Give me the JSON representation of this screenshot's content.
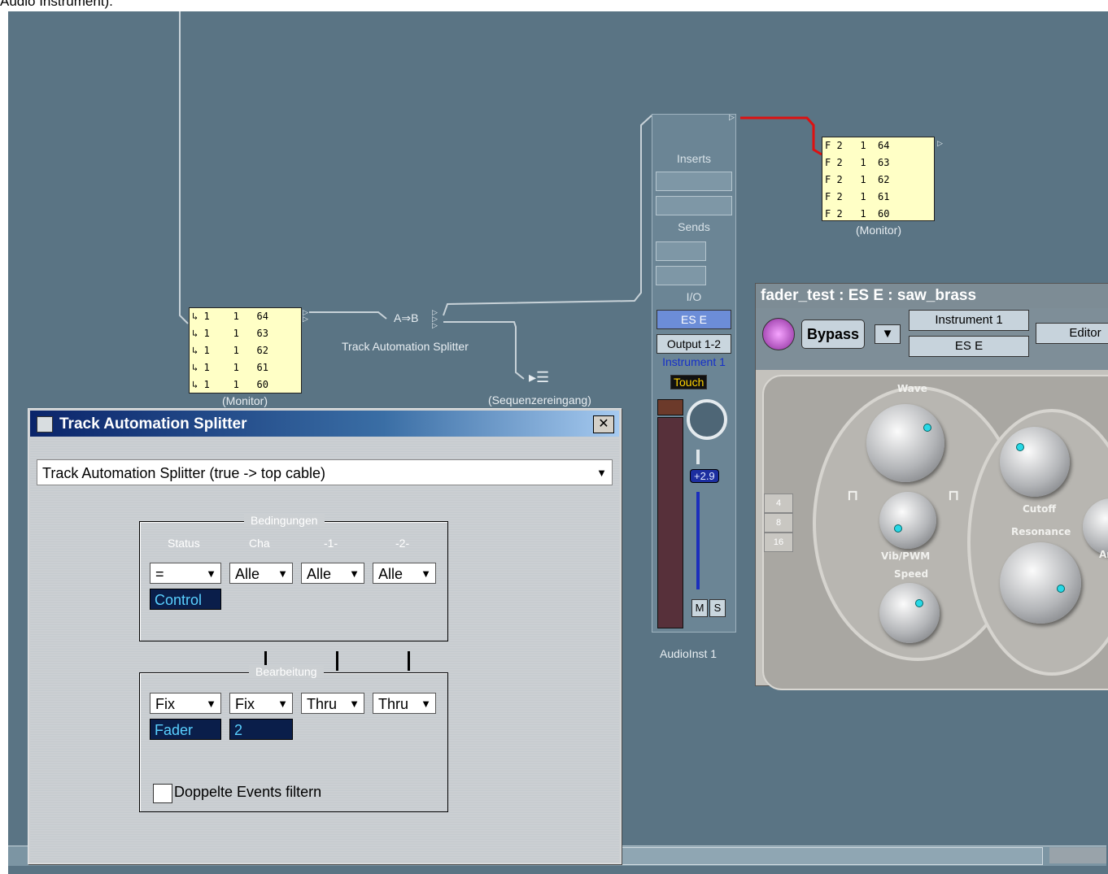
{
  "caption": "Audio Instrument).",
  "monitor_left": {
    "rows": [
      "↳ 1    1   64",
      "↳ 1    1   63",
      "↳ 1    1   62",
      "↳ 1    1   61",
      "↳ 1    1   60"
    ],
    "label": "(Monitor)"
  },
  "monitor_right": {
    "rows": [
      "F 2   1  64",
      "F 2   1  63",
      "F 2   1  62",
      "F 2   1  61",
      "F 2   1  60"
    ],
    "label": "(Monitor)"
  },
  "splitter_object": {
    "glyph": "A⇒B",
    "label": "Track Automation Splitter"
  },
  "sequencer_input": {
    "label": "(Sequenzereingang)"
  },
  "channel_strip": {
    "inserts_label": "Inserts",
    "sends_label": "Sends",
    "io_label": "I/O",
    "input": "ES E",
    "output": "Output 1-2",
    "instrument": "Instrument 1",
    "automation": "Touch",
    "volume": "+2.9",
    "mute": "M",
    "solo": "S",
    "name": "AudioInst 1",
    "cable_color": "#dd1111"
  },
  "dialog": {
    "title": "Track Automation Splitter",
    "close": "✕",
    "preset": "Track Automation Splitter (true -> top cable)",
    "conditions": {
      "legend": "Bedingungen",
      "headers": [
        "Status",
        "Cha",
        "-1-",
        "-2-"
      ],
      "selects": [
        "=",
        "Alle",
        "Alle",
        "Alle"
      ],
      "value": "Control"
    },
    "processing": {
      "legend": "Bearbeitung",
      "selects": [
        "Fix",
        "Fix",
        "Thru",
        "Thru"
      ],
      "values": [
        "Fader",
        "2"
      ]
    },
    "checkbox_label": "Doppelte Events filtern",
    "checkbox_checked": false
  },
  "plugin": {
    "title": "fader_test : ES E : saw_brass",
    "bypass": "Bypass",
    "instrument": "Instrument 1",
    "plugin_name": "ES E",
    "editor": "Editor",
    "labels": {
      "wave": "Wave",
      "vib": "Vib/PWM",
      "speed": "Speed",
      "cutoff": "Cutoff",
      "resonance": "Resonance",
      "ar": "Ar"
    },
    "octave": [
      "4",
      "8",
      "16"
    ],
    "accent_color": "#28d8e6"
  }
}
